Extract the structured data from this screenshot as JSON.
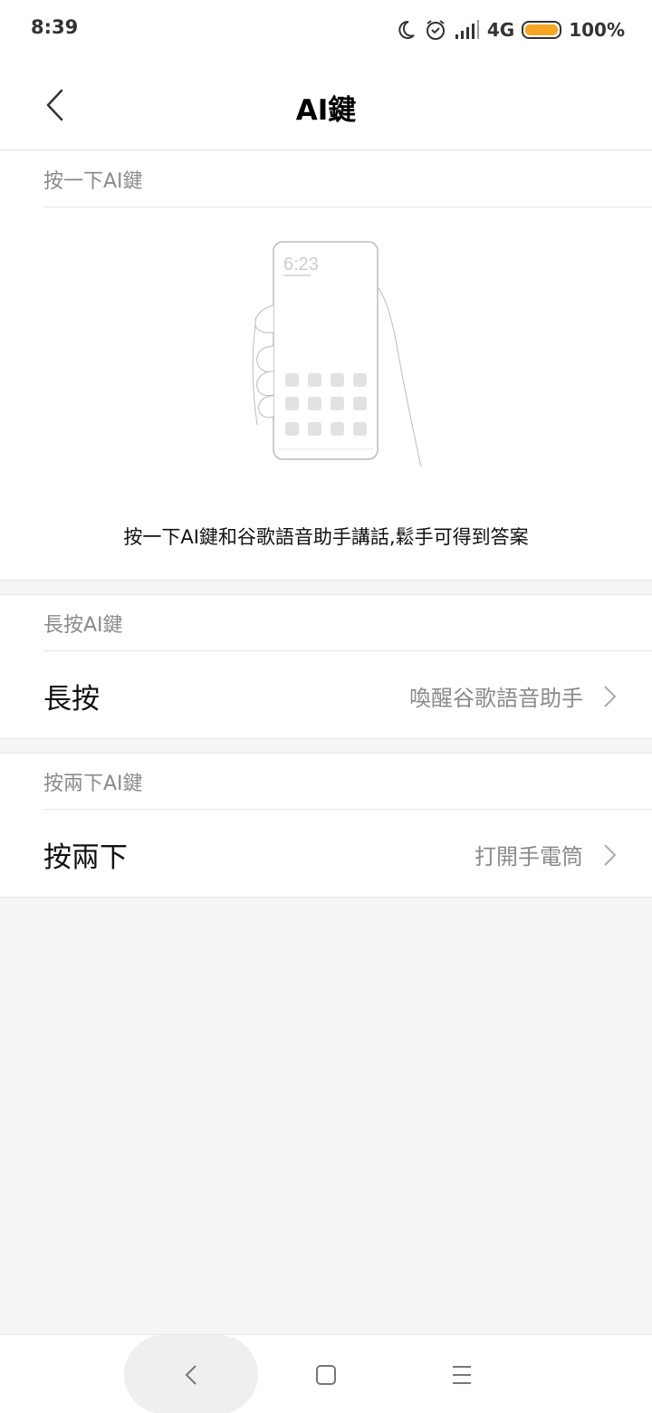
{
  "status_bar": {
    "time": "8:39",
    "network": "4G",
    "battery": "100%",
    "icons": [
      "moon-icon",
      "alarm-icon",
      "signal-icon",
      "battery-icon"
    ],
    "battery_color": "#f5a623"
  },
  "header": {
    "title": "AI鍵",
    "back_icon": "chevron-left-icon"
  },
  "section_press_once": {
    "header": "按一下AI鍵",
    "illustration_time": "6:23",
    "caption": "按一下AI鍵和谷歌語音助手講話,鬆手可得到答案"
  },
  "section_long_press": {
    "header": "長按AI鍵",
    "row_label": "長按",
    "row_value": "喚醒谷歌語音助手"
  },
  "section_double_press": {
    "header": "按兩下AI鍵",
    "row_label": "按兩下",
    "row_value": "打開手電筒"
  },
  "nav_bar": {
    "icons": [
      "back-icon",
      "home-icon",
      "recents-icon"
    ]
  }
}
